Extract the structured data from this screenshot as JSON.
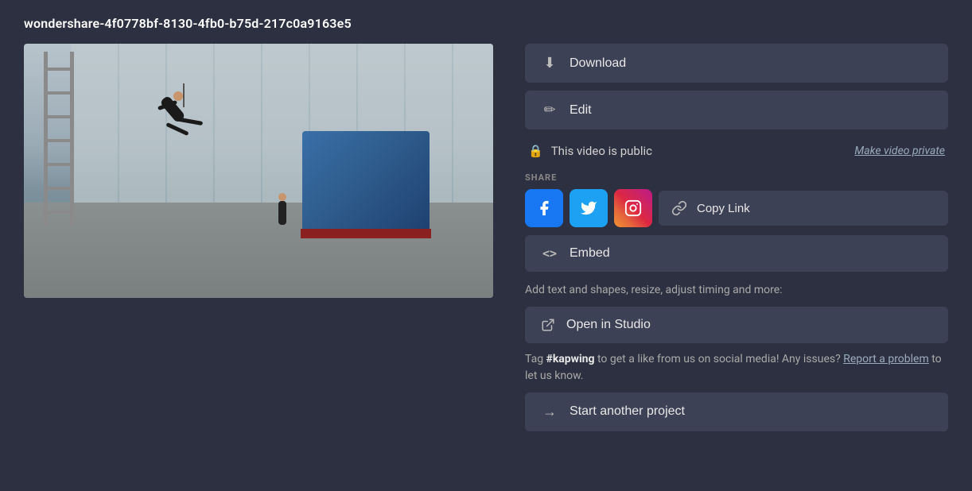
{
  "page": {
    "title": "wondershare-4f0778bf-8130-4fb0-b75d-217c0a9163e5"
  },
  "actions": {
    "download_label": "Download",
    "edit_label": "Edit",
    "embed_label": "Embed",
    "open_studio_label": "Open in Studio",
    "start_project_label": "Start another project",
    "copy_link_label": "Copy Link"
  },
  "privacy": {
    "status_label": "This video is public",
    "make_private_label": "Make video private"
  },
  "share": {
    "section_label": "SHARE",
    "facebook_label": "f",
    "twitter_label": "t",
    "instagram_label": "ig",
    "copy_icon": "🔗"
  },
  "info": {
    "studio_hint": "Add text and shapes, resize, adjust timing and more:",
    "tag_text_before": "Tag ",
    "tag_bold": "#kapwing",
    "tag_text_after": " to get a like from us on social media! Any issues?",
    "report_link": "Report a problem",
    "tag_text_end": " to let us know."
  },
  "icons": {
    "download": "⬇",
    "edit": "✏",
    "lock": "🔒",
    "link": "🔗",
    "embed": "<>",
    "open_external": "⧉",
    "arrow_right": "→"
  }
}
